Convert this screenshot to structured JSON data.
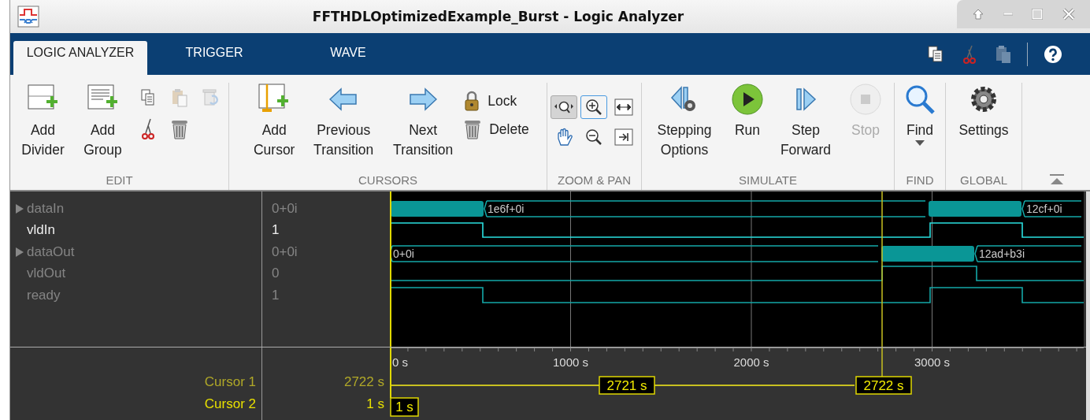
{
  "window": {
    "title": "FFTHDLOptimizedExample_Burst - Logic Analyzer"
  },
  "tabs": [
    {
      "label": "LOGIC ANALYZER",
      "selected": true
    },
    {
      "label": "TRIGGER",
      "selected": false
    },
    {
      "label": "WAVE",
      "selected": false
    }
  ],
  "toolstrip": {
    "edit": {
      "label": "EDIT",
      "buttons": [
        {
          "label": "Add\nDivider"
        },
        {
          "label": "Add\nGroup"
        }
      ],
      "small": [
        {
          "disabled": false
        },
        {
          "disabled": true
        },
        {
          "disabled": true
        },
        {
          "disabled": false
        },
        {
          "disabled": false
        }
      ]
    },
    "cursors": {
      "label": "CURSORS",
      "buttons": [
        {
          "label": "Add\nCursor"
        },
        {
          "label": "Previous\nTransition"
        },
        {
          "label": "Next\nTransition"
        }
      ],
      "small": [
        {
          "label": "Lock"
        },
        {
          "label": "Delete"
        }
      ]
    },
    "zoom": {
      "label": "ZOOM & PAN",
      "tools": [
        {
          "selected": true,
          "focused": false
        },
        {
          "selected": false,
          "focused": true
        },
        {
          "selected": false,
          "focused": false
        },
        {
          "selected": false,
          "focused": false
        },
        {
          "selected": false,
          "focused": false
        },
        {
          "selected": false,
          "focused": false
        }
      ]
    },
    "simulate": {
      "label": "SIMULATE",
      "buttons": [
        {
          "label": "Stepping\nOptions",
          "disabled": false
        },
        {
          "label": "Run",
          "disabled": false
        },
        {
          "label": "Step\nForward",
          "disabled": false
        },
        {
          "label": "Stop",
          "disabled": true
        }
      ]
    },
    "find": {
      "label": "FIND",
      "button": "Find"
    },
    "global": {
      "label": "GLOBAL",
      "button": "Settings"
    }
  },
  "signals": [
    {
      "name": "dataIn",
      "kind": "bus",
      "expandable": true,
      "selected": false,
      "value": "0+0i",
      "bus_labels": [
        "1e6f+0i",
        "12cf+0i"
      ]
    },
    {
      "name": "vldIn",
      "kind": "bit",
      "expandable": false,
      "selected": true,
      "value": "1"
    },
    {
      "name": "dataOut",
      "kind": "bus",
      "expandable": true,
      "selected": false,
      "value": "0+0i",
      "bus_labels": [
        "0+0i",
        "12ad+b3i"
      ]
    },
    {
      "name": "vldOut",
      "kind": "bit",
      "expandable": false,
      "selected": false,
      "value": "0"
    },
    {
      "name": "ready",
      "kind": "bit",
      "expandable": false,
      "selected": false,
      "value": "1"
    }
  ],
  "axis": {
    "ticks": [
      "0 s",
      "1000 s",
      "2000 s",
      "3000 s"
    ]
  },
  "cursors": [
    {
      "name": "Cursor 1",
      "value": "2722 s",
      "selected": false,
      "delta_label": "2721 s",
      "position_label": "2722 s"
    },
    {
      "name": "Cursor 2",
      "value": "1 s",
      "selected": true,
      "position_label": "1 s"
    }
  ]
}
